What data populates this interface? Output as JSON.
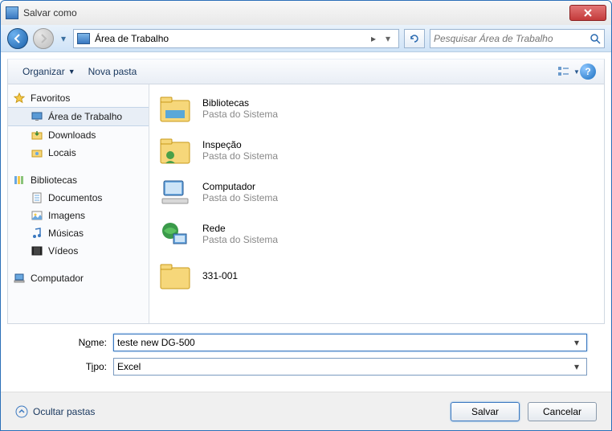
{
  "window": {
    "title": "Salvar como"
  },
  "nav": {
    "location": "Área de Trabalho",
    "search_placeholder": "Pesquisar Área de Trabalho"
  },
  "toolbar": {
    "organize": "Organizar",
    "new_folder": "Nova pasta"
  },
  "sidebar": {
    "favorites": {
      "label": "Favoritos",
      "items": [
        {
          "label": "Área de Trabalho",
          "key": "desktop",
          "selected": true
        },
        {
          "label": "Downloads",
          "key": "downloads"
        },
        {
          "label": "Locais",
          "key": "places"
        }
      ]
    },
    "libraries": {
      "label": "Bibliotecas",
      "items": [
        {
          "label": "Documentos",
          "key": "documents"
        },
        {
          "label": "Imagens",
          "key": "pictures"
        },
        {
          "label": "Músicas",
          "key": "music"
        },
        {
          "label": "Vídeos",
          "key": "videos"
        }
      ]
    },
    "computer": {
      "label": "Computador"
    }
  },
  "files": [
    {
      "name": "Bibliotecas",
      "sub": "Pasta do Sistema",
      "icon": "libraries"
    },
    {
      "name": "Inspeção",
      "sub": "Pasta do Sistema",
      "icon": "user-folder"
    },
    {
      "name": "Computador",
      "sub": "Pasta do Sistema",
      "icon": "computer"
    },
    {
      "name": "Rede",
      "sub": "Pasta do Sistema",
      "icon": "network"
    },
    {
      "name": "331-001",
      "sub": "",
      "icon": "folder"
    }
  ],
  "fields": {
    "name_label_pre": "N",
    "name_label_u": "o",
    "name_label_post": "me:",
    "name_value": "teste new DG-500",
    "type_label_pre": "T",
    "type_label_u": "i",
    "type_label_post": "po:",
    "type_value": "Excel"
  },
  "footer": {
    "hide_folders": "Ocultar pastas",
    "save": "Salvar",
    "cancel": "Cancelar"
  }
}
